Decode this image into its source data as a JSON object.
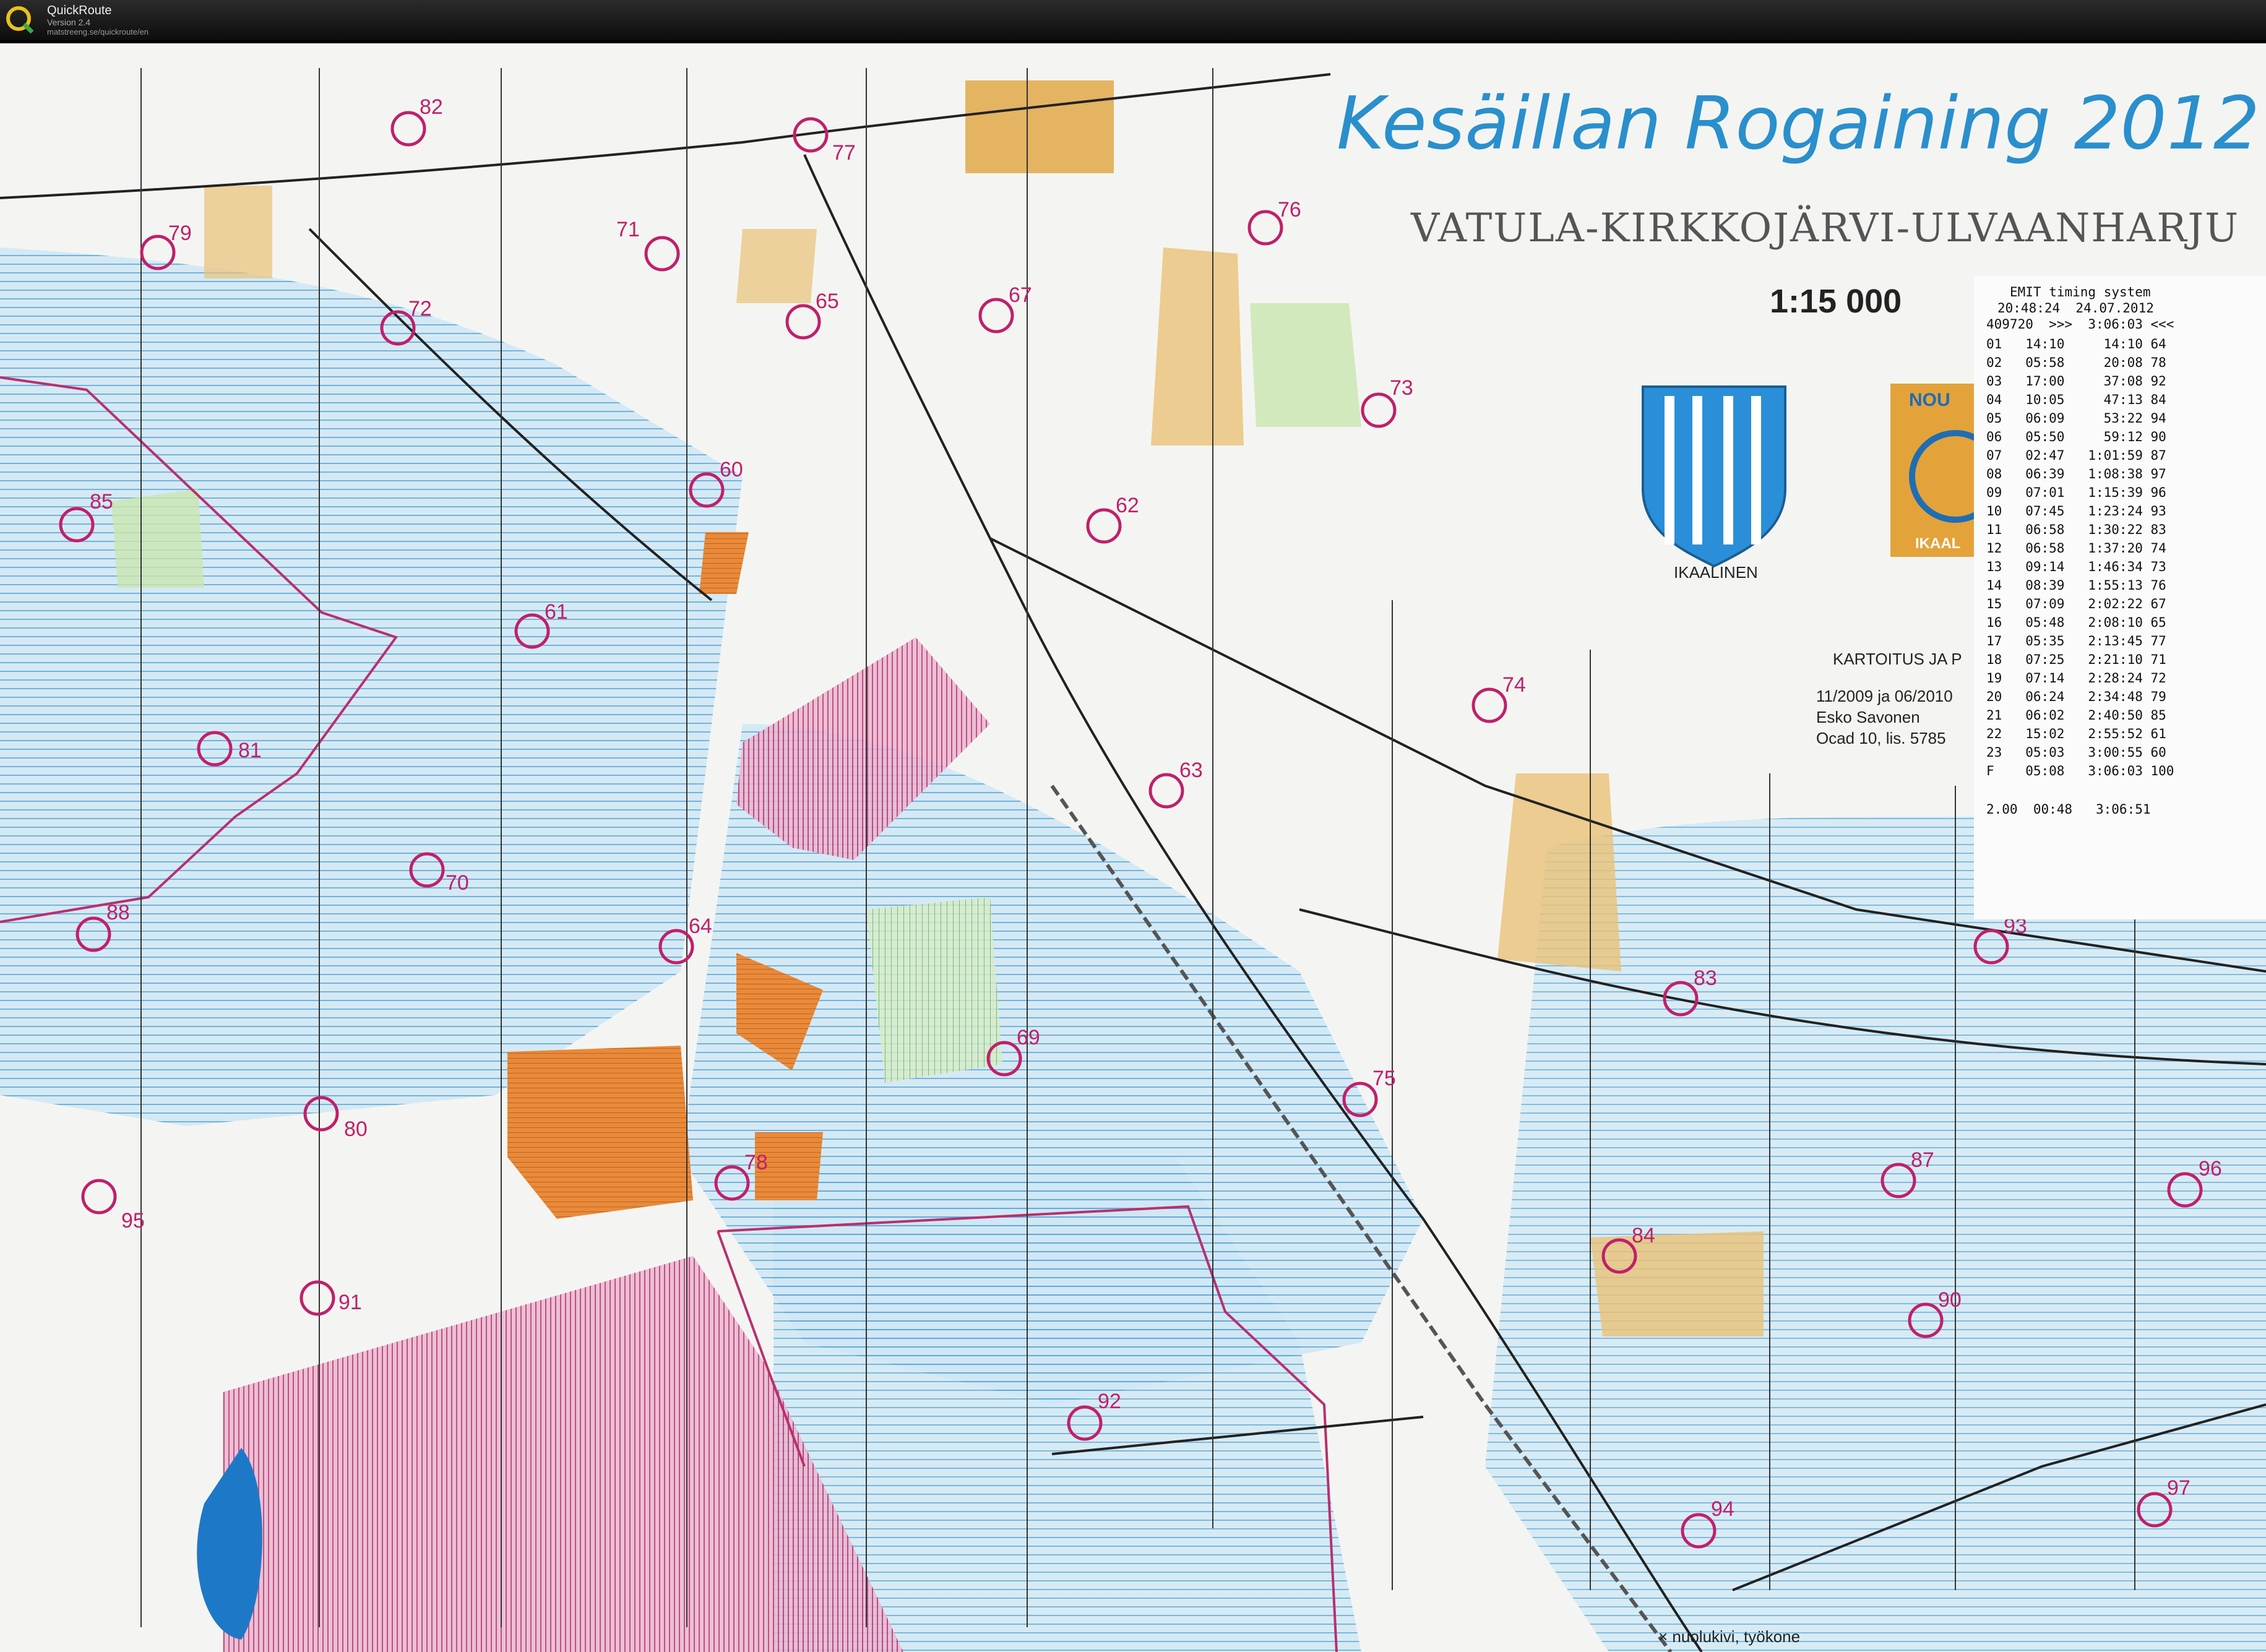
{
  "app": {
    "name": "QuickRoute",
    "version": "Version 2.4",
    "url": "matstreeng.se/quickroute/en"
  },
  "map": {
    "title": "Kesäillan Rogaining 2012",
    "subtitle": "VATULA-KIRKKOJÄRVI-ULVAANHARJU",
    "scale": "1:15 000",
    "emblem_left_label": "IKAALINEN",
    "emblem_right_label_top": "NOU",
    "emblem_right_label_bottom": "IKAAL",
    "credit_lines": [
      "KARTOITUS JA P",
      "11/2009 ja 06/2010",
      "Esko Savonen",
      "Ocad 10, lis. 5785"
    ],
    "legend_note": "× nuolukivi, työkone",
    "colors": {
      "open_land": "#e7c06a",
      "marsh": "#bfe0f2",
      "forest_green": "#b9dca0",
      "control_magenta": "#c0206a",
      "title_blue": "#2a8fcd",
      "settlement_orange": "#e88a3a",
      "out_of_bounds": "#c03a7a",
      "lake_blue": "#1e78c8"
    },
    "controls": [
      {
        "label": "82"
      },
      {
        "label": "77"
      },
      {
        "label": "79"
      },
      {
        "label": "71"
      },
      {
        "label": "76"
      },
      {
        "label": "65"
      },
      {
        "label": "67"
      },
      {
        "label": "72"
      },
      {
        "label": "73"
      },
      {
        "label": "85"
      },
      {
        "label": "60"
      },
      {
        "label": "62"
      },
      {
        "label": "61"
      },
      {
        "label": "74"
      },
      {
        "label": "81"
      },
      {
        "label": "63"
      },
      {
        "label": "70"
      },
      {
        "label": "88"
      },
      {
        "label": "64"
      },
      {
        "label": "93"
      },
      {
        "label": "83"
      },
      {
        "label": "69"
      },
      {
        "label": "75"
      },
      {
        "label": "80"
      },
      {
        "label": "78"
      },
      {
        "label": "87"
      },
      {
        "label": "96"
      },
      {
        "label": "95"
      },
      {
        "label": "84"
      },
      {
        "label": "91"
      },
      {
        "label": "90"
      },
      {
        "label": "92"
      },
      {
        "label": "97"
      },
      {
        "label": "94"
      }
    ]
  },
  "timing": {
    "header": "EMIT timing system",
    "datetime": "20:48:24  24.07.2012",
    "card": "409720  >>>  3:06:03 <<<",
    "rows": [
      "01   14:10     14:10 64",
      "02   05:58     20:08 78",
      "03   17:00     37:08 92",
      "04   10:05     47:13 84",
      "05   06:09     53:22 94",
      "06   05:50     59:12 90",
      "07   02:47   1:01:59 87",
      "08   06:39   1:08:38 97",
      "09   07:01   1:15:39 96",
      "10   07:45   1:23:24 93",
      "11   06:58   1:30:22 83",
      "12   06:58   1:37:20 74",
      "13   09:14   1:46:34 73",
      "14   08:39   1:55:13 76",
      "15   07:09   2:02:22 67",
      "16   05:48   2:08:10 65",
      "17   05:35   2:13:45 77",
      "18   07:25   2:21:10 71",
      "19   07:14   2:28:24 72",
      "20   06:24   2:34:48 79",
      "21   06:02   2:40:50 85",
      "22   15:02   2:55:52 61",
      "23   05:03   3:00:55 60",
      "F    05:08   3:06:03 100"
    ],
    "footer": "2.00  00:48   3:06:51"
  }
}
